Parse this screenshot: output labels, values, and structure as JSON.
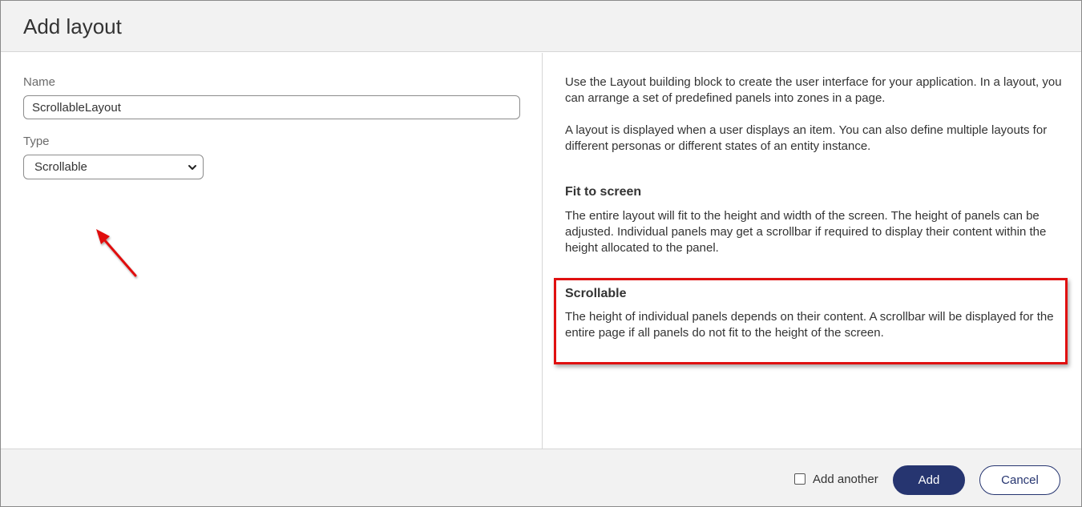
{
  "dialog": {
    "title": "Add layout"
  },
  "form": {
    "name_label": "Name",
    "name_value": "ScrollableLayout",
    "type_label": "Type",
    "type_value": "Scrollable"
  },
  "help": {
    "intro_1": "Use the Layout building block to create the user interface for your application. In a layout, you can arrange a set of predefined panels into zones in a page.",
    "intro_2": "A layout is displayed when a user displays an item. You can also define multiple layouts for different personas or different states of an entity instance.",
    "fit_title": "Fit to screen",
    "fit_body": "The entire layout will fit to the height and width of the screen. The height of panels can be adjusted. Individual panels may get a scrollbar if required to display their content within the height allocated to the panel.",
    "scroll_title": "Scrollable",
    "scroll_body": "The height of individual panels depends on their content. A scrollbar will be displayed for the entire page if all panels do not fit to the height of the screen."
  },
  "footer": {
    "add_another_label": "Add another",
    "add_another_checked": false,
    "add_label": "Add",
    "cancel_label": "Cancel"
  },
  "colors": {
    "primary": "#263570",
    "annotation": "#e01010"
  },
  "icons": {
    "select_chevron": "chevron-down-icon",
    "annotation_arrow": "arrow-icon"
  }
}
